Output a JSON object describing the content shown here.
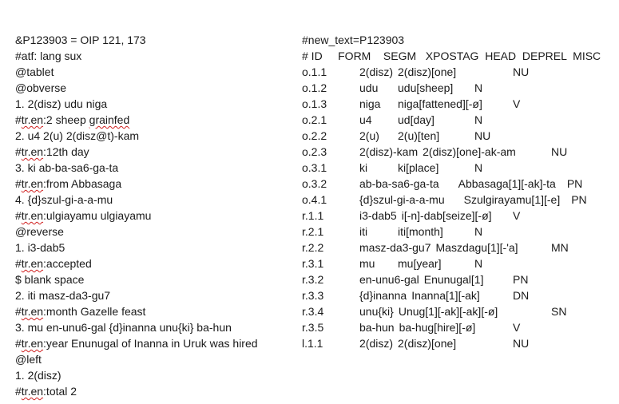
{
  "left_lines": [
    "&P123903 = OIP 121, 173",
    "#atf: lang sux",
    "@tablet",
    "@obverse",
    "1. 2(disz) udu niga",
    "#tr.en:2 sheep grainfed",
    "2. u4 2(u) 2(disz@t)-kam",
    "#tr.en:12th day",
    "3. ki ab-ba-sa6-ga-ta",
    "#tr.en:from Abbasaga",
    "4. {d}szul-gi-a-a-mu",
    "#tr.en:ulgiayamu ulgiayamu",
    "@reverse",
    "1. i3-dab5",
    "#tr.en:accepted",
    "$ blank space",
    "2. iti masz-da3-gu7",
    "#tr.en:month Gazelle feast",
    "3. mu en-unu6-gal {d}inanna unu{ki} ba-hun",
    "#tr.en:year Enunugal of Inanna in Uruk was hired",
    "@left",
    "1. 2(disz)",
    "#tr.en:total 2"
  ],
  "right_header": {
    "new_text": "#new_text=P123903",
    "columns": "# ID     FORM    SEGM   XPOSTAG  HEAD  DEPREL  MISC"
  },
  "rows": [
    {
      "id": "o.1.1",
      "form": "2(disz)",
      "segm": "2(disz)[one]",
      "xpos": "NU",
      "head": "",
      "deprel": ""
    },
    {
      "id": "o.1.2",
      "form": "udu",
      "segm": "udu[sheep]",
      "xpos": "N",
      "head": "",
      "deprel": ""
    },
    {
      "id": "o.1.3",
      "form": "niga",
      "segm": "niga[fattened][-ø]",
      "xpos": "V",
      "head": "",
      "deprel": ""
    },
    {
      "id": "o.2.1",
      "form": "u4",
      "segm": "ud[day]",
      "xpos": "N",
      "head": "",
      "deprel": ""
    },
    {
      "id": "o.2.2",
      "form": "2(u)",
      "segm": "2(u)[ten]",
      "xpos": "NU",
      "head": "",
      "deprel": ""
    },
    {
      "id": "o.2.3",
      "form": "2(disz)-kam",
      "segm": "2(disz)[one]-ak-am",
      "xpos": "NU",
      "head": "",
      "deprel": ""
    },
    {
      "id": "o.3.1",
      "form": "ki",
      "segm": "ki[place]",
      "xpos": "N",
      "head": "",
      "deprel": ""
    },
    {
      "id": "o.3.2",
      "form": "ab-ba-sa6-ga-ta",
      "segm": "Abbasaga[1][-ak]-ta",
      "xpos": "PN",
      "head": "",
      "deprel": ""
    },
    {
      "id": "o.4.1",
      "form": "{d}szul-gi-a-a-mu",
      "segm": "Szulgirayamu[1][-e]",
      "xpos": "PN",
      "head": "",
      "deprel": ""
    },
    {
      "id": "r.1.1",
      "form": "i3-dab5",
      "segm": "i[-n]-dab[seize][-ø]",
      "xpos": "V",
      "head": "",
      "deprel": ""
    },
    {
      "id": "r.2.1",
      "form": "iti",
      "segm": "iti[month]",
      "xpos": "N",
      "head": "",
      "deprel": ""
    },
    {
      "id": "r.2.2",
      "form": "masz-da3-gu7",
      "segm": "Maszdagu[1][-'a]",
      "xpos": "MN",
      "head": "",
      "deprel": ""
    },
    {
      "id": "r.3.1",
      "form": "mu",
      "segm": "mu[year]",
      "xpos": "N",
      "head": "",
      "deprel": ""
    },
    {
      "id": "r.3.2",
      "form": "en-unu6-gal",
      "segm": "Enunugal[1]",
      "xpos": "PN",
      "head": "",
      "deprel": ""
    },
    {
      "id": "r.3.3",
      "form": "{d}inanna",
      "segm": "Inanna[1][-ak]",
      "xpos": "DN",
      "head": "",
      "deprel": ""
    },
    {
      "id": "r.3.4",
      "form": "unu{ki}",
      "segm": "Unug[1][-ak][-ak][-ø]",
      "xpos": "SN",
      "head": "",
      "deprel": ""
    },
    {
      "id": "r.3.5",
      "form": "ba-hun",
      "segm": "ba-hug[hire][-ø]",
      "xpos": "V",
      "head": "",
      "deprel": ""
    },
    {
      "id": "l.1.1",
      "form": "2(disz)",
      "segm": "2(disz)[one]",
      "xpos": "NU",
      "head": "",
      "deprel": ""
    }
  ],
  "spellcheck_underline_color": "#d02020"
}
